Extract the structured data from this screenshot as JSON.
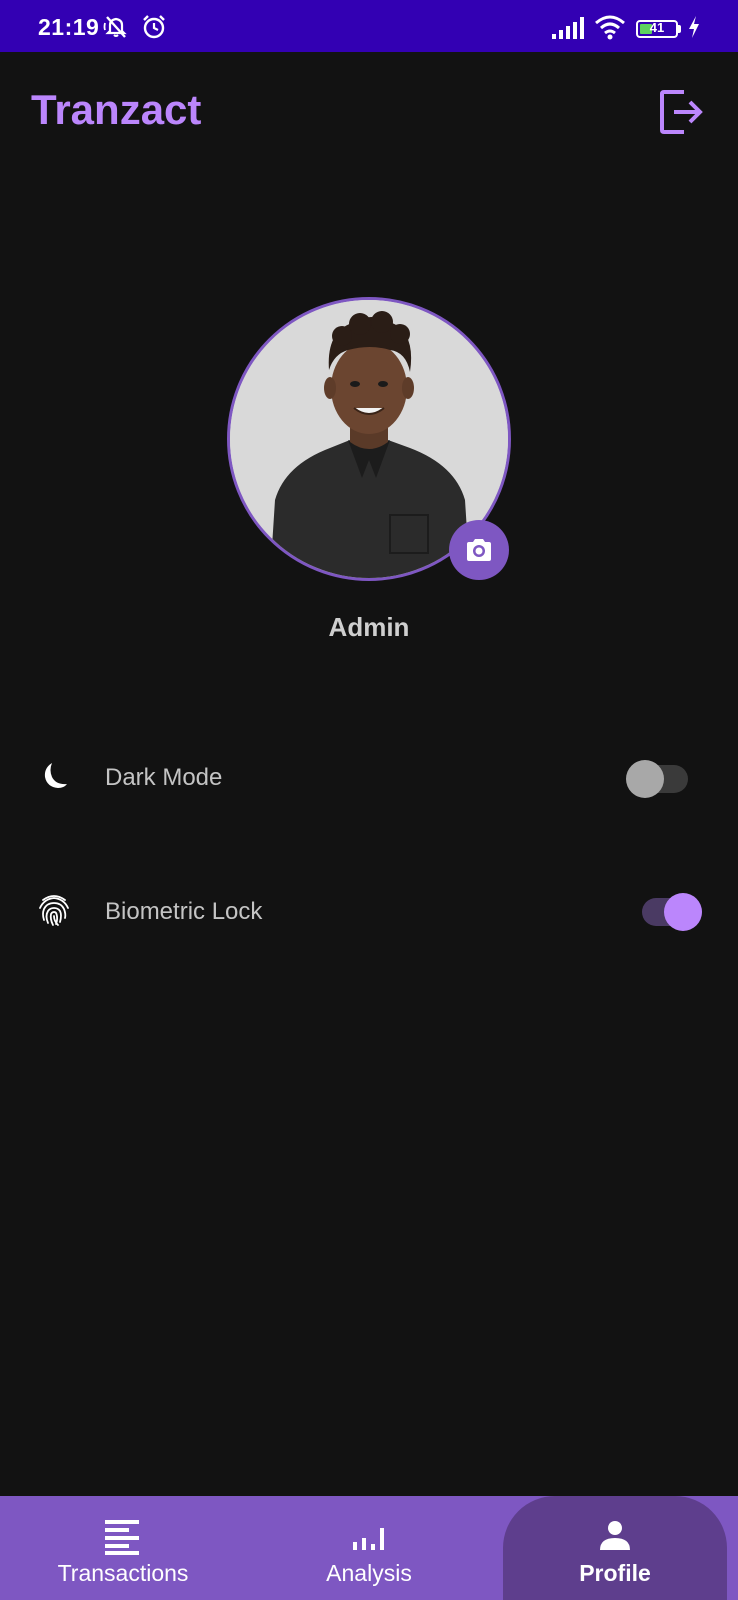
{
  "status_bar": {
    "time": "21:19",
    "battery_level": "41",
    "icons": [
      "mute-icon",
      "alarm-icon",
      "signal-icon",
      "wifi-icon",
      "battery-icon",
      "charging-icon"
    ]
  },
  "app_bar": {
    "title": "Tranzact",
    "logout_icon": "logout-icon"
  },
  "profile": {
    "name": "Admin",
    "camera_icon": "camera-icon"
  },
  "settings": [
    {
      "label": "Dark Mode",
      "icon": "moon-icon",
      "enabled": false
    },
    {
      "label": "Biometric Lock",
      "icon": "fingerprint-icon",
      "enabled": true
    }
  ],
  "bottom_nav": {
    "items": [
      {
        "label": "Transactions",
        "icon": "list-icon",
        "active": false
      },
      {
        "label": "Analysis",
        "icon": "bar-chart-icon",
        "active": false
      },
      {
        "label": "Profile",
        "icon": "person-icon",
        "active": true
      }
    ]
  },
  "colors": {
    "status_bar": "#3300b3",
    "accent": "#bb86fc",
    "primary": "#7e57c2",
    "background": "#121212",
    "nav_active": "#5e3e8d"
  }
}
